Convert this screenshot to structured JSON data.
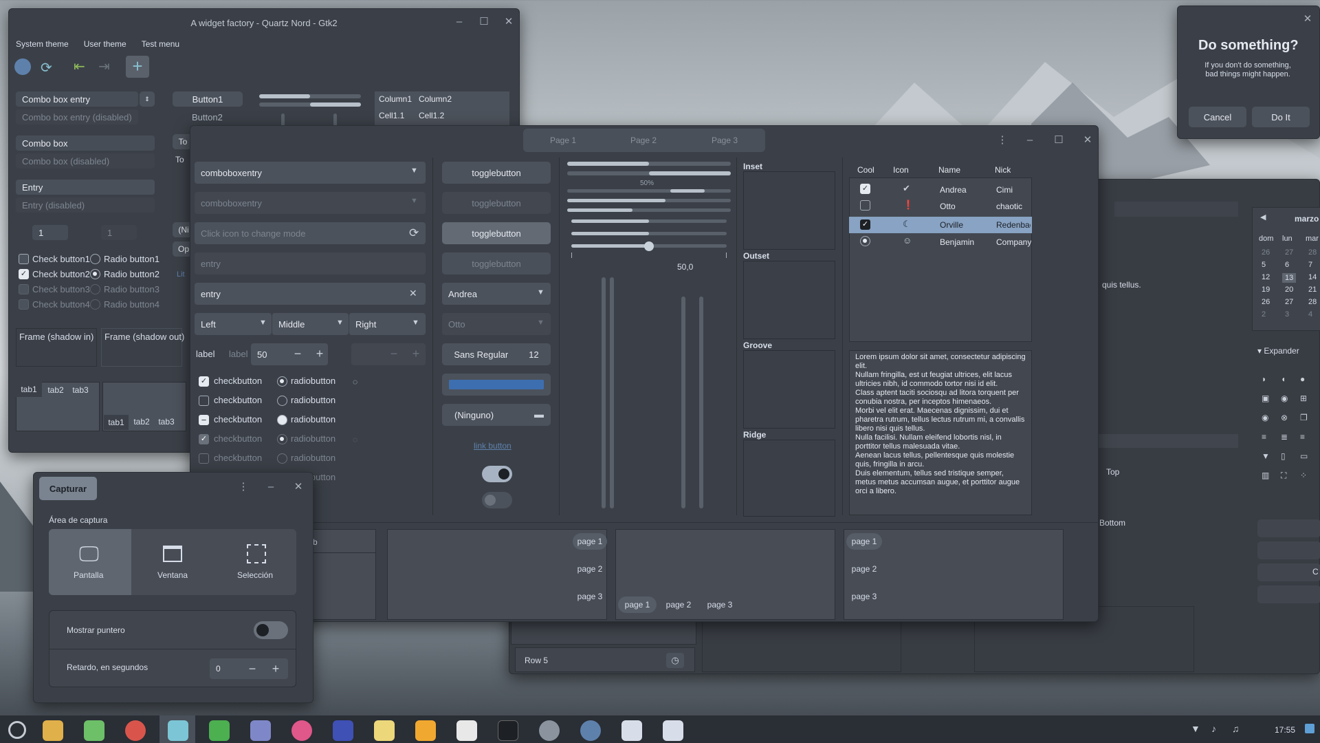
{
  "wf": {
    "title": "A widget factory - Quartz Nord - Gtk2",
    "menu": [
      "System theme",
      "User theme",
      "Test menu"
    ],
    "combo_entry": "Combo box entry",
    "combo_entry_dis": "Combo box entry (disabled)",
    "combo": "Combo box",
    "combo_dis": "Combo box (disabled)",
    "entry": "Entry",
    "entry_dis": "Entry (disabled)",
    "spin1": "1",
    "spin2": "1",
    "checks": [
      "Check button1",
      "Check button2",
      "Check button3",
      "Check button4"
    ],
    "radios": [
      "Radio button1",
      "Radio button2",
      "Radio button3",
      "Radio button4"
    ],
    "frame_in": "Frame (shadow in)",
    "frame_out": "Frame (shadow out)",
    "tabs": [
      "tab1",
      "tab2",
      "tab3"
    ],
    "button1": "Button1",
    "button2": "Button2",
    "col1": "Column1",
    "col2": "Column2",
    "cell11": "Cell1.1",
    "cell12": "Cell1.2",
    "partial_to": "To",
    "partial_n": "(Ni",
    "partial_op": "Op",
    "partial_lit": "Lit"
  },
  "gtk": {
    "pages": [
      "Page 1",
      "Page 2",
      "Page 3"
    ],
    "combos": [
      "comboboxentry",
      "comboboxentry"
    ],
    "icon_entry_ph": "Click icon to change mode",
    "entry1": "entry",
    "entry2": "entry",
    "lmr": [
      "Left",
      "Middle",
      "Right"
    ],
    "label1": "label",
    "label2": "label",
    "spin": "50",
    "cb": [
      "checkbutton",
      "checkbutton",
      "checkbutton",
      "checkbutton",
      "checkbutton"
    ],
    "rb": [
      "radiobutton",
      "radiobutton",
      "radiobutton",
      "radiobutton",
      "radiobutton",
      "radiobutton"
    ],
    "toggles": [
      "togglebutton",
      "togglebutton",
      "togglebutton",
      "togglebutton"
    ],
    "combo_andrea": "Andrea",
    "combo_otto": "Otto",
    "font_name": "Sans Regular",
    "font_size": "12",
    "file_btn": "(Ninguno)",
    "link": "link button",
    "progress_label": "50%",
    "scale_value": "50,0",
    "frames": [
      "Inset",
      "Outset",
      "Groove",
      "Ridge"
    ],
    "tree_headers": [
      "Cool",
      "Icon",
      "Name",
      "Nick"
    ],
    "tree_rows": [
      {
        "name": "Andrea",
        "nick": "Cimi"
      },
      {
        "name": "Otto",
        "nick": "chaotic"
      },
      {
        "name": "Orville",
        "nick": "Redenbac..."
      },
      {
        "name": "Benjamin",
        "nick": "Company"
      }
    ],
    "lorem": "Lorem ipsum dolor sit amet, consectetur adipiscing elit.\nNullam fringilla, est ut feugiat ultrices, elit lacus ultricies nibh, id commodo tortor nisi id elit.\nClass aptent taciti sociosqu ad litora torquent per conubia nostra, per inceptos himenaeos.\nMorbi vel elit erat. Maecenas dignissim, dui et pharetra rutrum, tellus lectus rutrum mi, a convallis libero nisi quis tellus.\nNulla facilisi. Nullam eleifend lobortis nisl, in porttitor tellus malesuada vitae.\nAenean lacus tellus, pellentesque quis molestie quis, fringilla in arcu.\nDuis elementum, tellus sed tristique semper, metus metus accumsan augue, et porttitor augue orci a libero.",
    "nb_pages": [
      "page 1",
      "page 2",
      "page 3"
    ],
    "partial_b": "b"
  },
  "dlg": {
    "title": "Do something?",
    "body": "If you don't do something,\nbad things might happen.",
    "cancel": "Cancel",
    "doit": "Do It"
  },
  "bg": {
    "month": "marzo",
    "days": [
      "dom",
      "lun",
      "mar"
    ],
    "cal": [
      [
        "26",
        "27",
        "28"
      ],
      [
        "5",
        "6",
        "7"
      ],
      [
        "12",
        "13",
        "14"
      ],
      [
        "19",
        "20",
        "21"
      ],
      [
        "26",
        "27",
        "28"
      ],
      [
        "2",
        "3",
        "4"
      ]
    ],
    "expander": "Expander",
    "tellus": "quis tellus.",
    "top": "Top",
    "bottom": "Bottom",
    "row5": "Row 5",
    "partial_c": "C"
  },
  "cap": {
    "title": "Capturar",
    "area": "Área de captura",
    "modes": [
      "Pantalla",
      "Ventana",
      "Selección"
    ],
    "pointer": "Mostrar puntero",
    "delay": "Retardo, en segundos",
    "delay_val": "0"
  },
  "taskbar": {
    "time": "17:55"
  }
}
